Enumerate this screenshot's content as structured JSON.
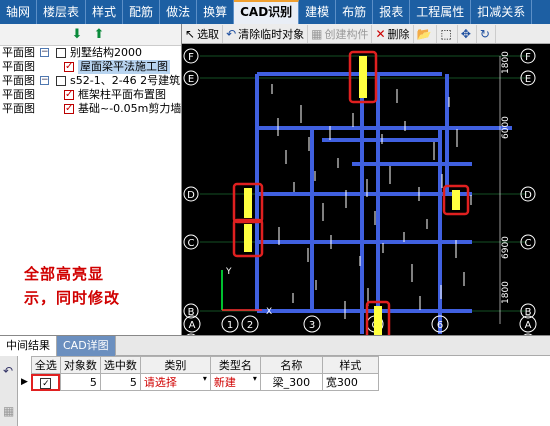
{
  "menu": [
    "轴网",
    "楼层表",
    "样式",
    "配筋",
    "做法",
    "换算",
    "CAD识别",
    "建模",
    "布筋",
    "报表",
    "工程属性",
    "扣减关系"
  ],
  "menu_active_index": 6,
  "tree": {
    "rows": [
      {
        "label": "平面图",
        "expand": "⊟",
        "checked": false,
        "name": "别墅结构2000",
        "selected": false
      },
      {
        "label": "平面图",
        "expand": "",
        "checked": true,
        "name": "屋面梁平法施工图",
        "selected": true
      },
      {
        "label": "平面图",
        "expand": "⊟",
        "checked": false,
        "name": "s52-1、2-46 2号建筑",
        "selected": false
      },
      {
        "label": "平面图",
        "expand": "",
        "checked": true,
        "name": "框架柱平面布置图",
        "selected": false
      },
      {
        "label": "平面图",
        "expand": "",
        "checked": true,
        "name": "基础~-0.05m剪力墙",
        "selected": false
      }
    ]
  },
  "annotation": {
    "line1": "全部高亮显",
    "line2": "示，同时修改"
  },
  "cad_toolbar": {
    "select": "选取",
    "clear": "清除临时对象",
    "create": "创建构件",
    "delete": "删除"
  },
  "axes": {
    "left_rows": [
      "F",
      "E",
      "D",
      "C",
      "B",
      "A"
    ],
    "right_rows": [
      "F",
      "E",
      "D",
      "C",
      "B",
      "A"
    ],
    "bottom_cols": [
      "A",
      "1",
      "2",
      "3",
      "C",
      "6",
      "A"
    ],
    "dims": [
      "1800",
      "6000",
      "6900",
      "1800"
    ]
  },
  "bottom_tabs": [
    "中间结果",
    "CAD详图"
  ],
  "table": {
    "headers": [
      "全选",
      "对象数",
      "选中数",
      "类别",
      "类型名",
      "名称",
      "样式"
    ],
    "row": {
      "all": "✓",
      "objects": "5",
      "selected": "5",
      "category": "请选择",
      "type": "新建",
      "name": "梁_300",
      "style": "宽300"
    }
  },
  "colors": {
    "menubar": "#1d5fa3",
    "beam": "#4060e0",
    "axis": "#ffffff",
    "highlight": "#e02020",
    "hatch": "#ffff00"
  }
}
